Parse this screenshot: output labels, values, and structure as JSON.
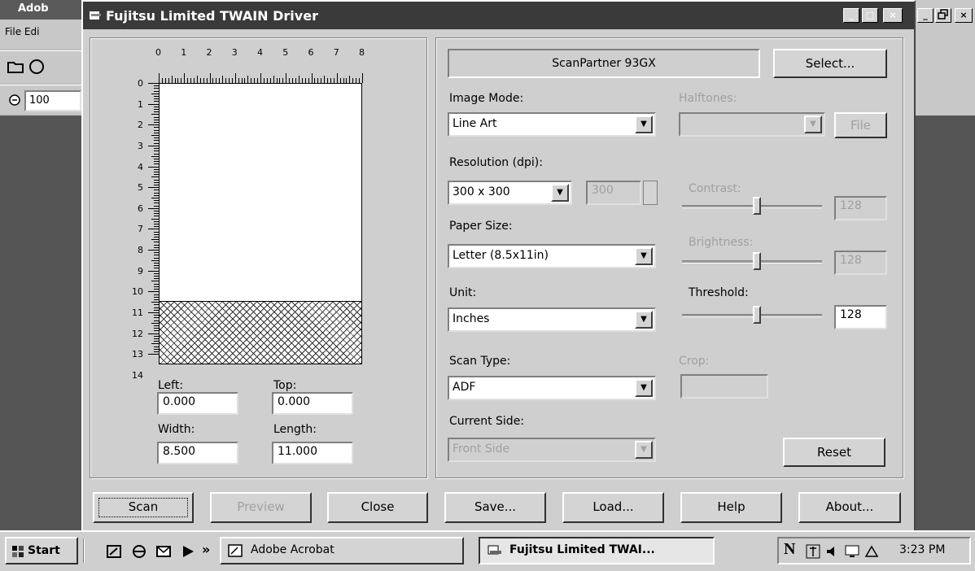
{
  "background_app": {
    "title": "Adob",
    "menu": "File  Edi",
    "zoom": "100",
    "controls": [
      "_",
      "×"
    ]
  },
  "window": {
    "title": "Fujitsu Limited TWAIN Driver",
    "controls": [
      "_",
      "□",
      "×"
    ]
  },
  "preview": {
    "ruler_x": [
      "0",
      "1",
      "2",
      "3",
      "4",
      "5",
      "6",
      "7",
      "8"
    ],
    "ruler_y": [
      "0",
      "1",
      "2",
      "3",
      "4",
      "5",
      "6",
      "7",
      "8",
      "9",
      "10",
      "11",
      "12",
      "13",
      "14"
    ],
    "left_label": "Left:",
    "left_value": "0.000",
    "top_label": "Top:",
    "top_value": "0.000",
    "width_label": "Width:",
    "width_value": "8.500",
    "length_label": "Length:",
    "length_value": "11.000"
  },
  "settings": {
    "scanner_name": "ScanPartner 93GX",
    "select_button": "Select...",
    "image_mode_label": "Image Mode:",
    "image_mode_value": "Line Art",
    "halftones_label": "Halftones:",
    "halftones_value": "",
    "file_button": "File",
    "resolution_label": "Resolution (dpi):",
    "resolution_value": "300 x 300",
    "resolution_custom": "300",
    "contrast_label": "Contrast:",
    "contrast_value": "128",
    "paper_size_label": "Paper Size:",
    "paper_size_value": "Letter (8.5x11in)",
    "brightness_label": "Brightness:",
    "brightness_value": "128",
    "unit_label": "Unit:",
    "unit_value": "Inches",
    "threshold_label": "Threshold:",
    "threshold_value": "128",
    "scan_type_label": "Scan Type:",
    "scan_type_value": "ADF",
    "crop_label": "Crop:",
    "current_side_label": "Current Side:",
    "current_side_value": "Front Side",
    "reset_button": "Reset"
  },
  "slider_levels": {
    "contrast": 0.5,
    "brightness": 0.5,
    "threshold": 0.5
  },
  "buttons": {
    "scan": "Scan",
    "preview": "Preview",
    "close": "Close",
    "save": "Save...",
    "load": "Load...",
    "help": "Help",
    "about": "About..."
  },
  "taskbar": {
    "start": "Start",
    "chevron": "»",
    "task_acrobat": "Adobe Acrobat",
    "task_twain": "Fujitsu Limited TWAI...",
    "clock": "3:23 PM",
    "tray_n": "N"
  }
}
